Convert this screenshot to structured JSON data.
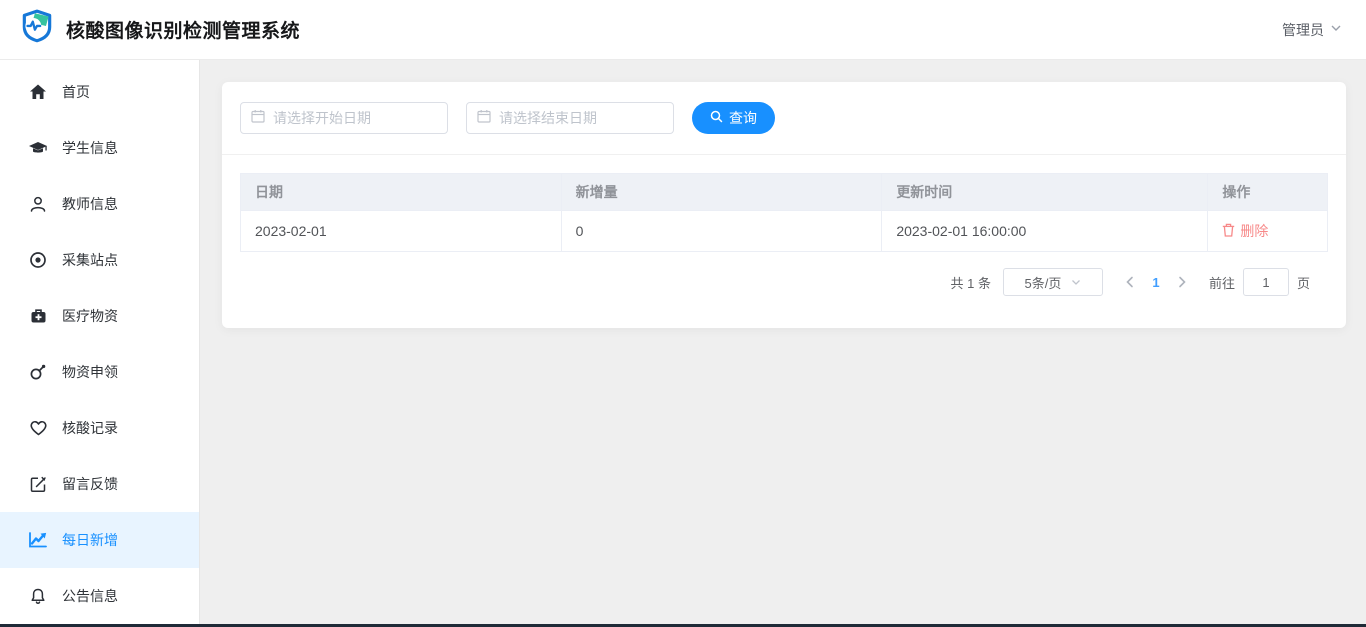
{
  "header": {
    "title": "核酸图像识别检测管理系统",
    "user_menu": "管理员"
  },
  "sidebar": {
    "items": [
      {
        "label": "首页",
        "icon": "home-icon"
      },
      {
        "label": "学生信息",
        "icon": "graduation-cap-icon"
      },
      {
        "label": "教师信息",
        "icon": "user-icon"
      },
      {
        "label": "采集站点",
        "icon": "target-icon"
      },
      {
        "label": "医疗物资",
        "icon": "medkit-icon"
      },
      {
        "label": "物资申领",
        "icon": "claim-icon"
      },
      {
        "label": "核酸记录",
        "icon": "heart-icon"
      },
      {
        "label": "留言反馈",
        "icon": "edit-square-icon"
      },
      {
        "label": "每日新增",
        "icon": "line-chart-icon",
        "active": true
      },
      {
        "label": "公告信息",
        "icon": "bell-icon"
      }
    ]
  },
  "search": {
    "start_placeholder": "请选择开始日期",
    "end_placeholder": "请选择结束日期",
    "button_label": "查询"
  },
  "table": {
    "headers": [
      "日期",
      "新增量",
      "更新时间",
      "操作"
    ],
    "rows": [
      {
        "date": "2023-02-01",
        "count": "0",
        "updated": "2023-02-01 16:00:00",
        "action_label": "删除"
      }
    ]
  },
  "pagination": {
    "total": "共 1 条",
    "page_size": "5条/页",
    "current_page": "1",
    "goto_label": "前往",
    "goto_value": "1",
    "page_unit": "页"
  },
  "icons": {
    "logo": "shield-with-pulse",
    "user_menu_chevron": "chevron-down",
    "date_field": "calendar",
    "search_button": "magnifier",
    "delete_action": "trash",
    "page_prev": "chevron-left",
    "page_next": "chevron-right",
    "page_size_chevron": "chevron-down"
  },
  "colors": {
    "primary": "#1890ff",
    "sidebar_active_bg": "#e8f4ff",
    "danger": "#f78989",
    "table_header_bg": "#eef1f6",
    "main_bg": "#efefef"
  }
}
